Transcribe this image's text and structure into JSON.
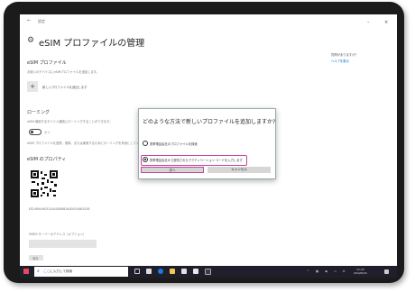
{
  "window": {
    "back": "←",
    "app_name": "設定",
    "minimize": "–",
    "close": "×"
  },
  "header": {
    "title": "eSIM プロファイルの管理",
    "gear_icon": "gear-icon"
  },
  "right_panel": {
    "heading": "質問がありますか？",
    "link": "ヘルプを表示"
  },
  "esim_profiles": {
    "heading": "eSIM プロファイル",
    "description": "お使いのデバイスにeSIMプロファイルを追加します。",
    "add_label": "新しいプロファイルを追加します"
  },
  "roaming": {
    "heading": "ローミング",
    "description": "eSIM 使用するモバイル通信にローミングすることができます。",
    "toggle_label": "オン",
    "note": "eSIM プロファイルを選択、削除、または使用するためにローミングを有効にしてください。"
  },
  "esim_props": {
    "heading": "eSIM のプロパティ",
    "eid": "EID:89049032004008882600034062038",
    "field_label": "SMDS サーバーのアドレス（オプション）",
    "button": "保存"
  },
  "dialog": {
    "title": "どのような方法で新しいプロファイルを追加しますか?",
    "option1": "携帯電話会社のプロファイルを検索",
    "option2": "携帯電話会社から提供されたアクティベーション コードを入力します",
    "next": "次へ",
    "cancel": "キャンセル"
  },
  "taskbar": {
    "search_placeholder": "ここに入力して検索",
    "time": "12:25",
    "date": "2020/06/15",
    "lang": "A"
  },
  "colors": {
    "highlight": "#c4449a",
    "link": "#0067b8",
    "taskbar": "#1f1f2b"
  }
}
